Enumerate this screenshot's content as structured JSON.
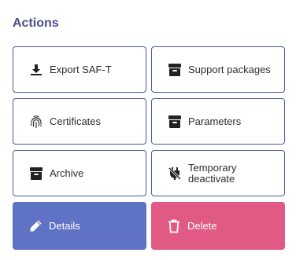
{
  "actions": {
    "title": "Actions",
    "buttons": [
      {
        "label": "Export SAF-T",
        "icon": "download-icon"
      },
      {
        "label": "Support packages",
        "icon": "archive-box-icon"
      },
      {
        "label": "Certificates",
        "icon": "fingerprint-icon"
      },
      {
        "label": "Parameters",
        "icon": "archive-box-icon"
      },
      {
        "label": "Archive",
        "icon": "archive-box-icon"
      },
      {
        "label": "Temporary deactivate",
        "icon": "unplug-icon"
      },
      {
        "label": "Details",
        "icon": "pencil-icon"
      },
      {
        "label": "Delete",
        "icon": "trash-icon"
      }
    ]
  },
  "colors": {
    "title": "#4a4e8a",
    "border": "#4a5a9c",
    "details_bg": "#5f72c4",
    "delete_bg": "#e05a83"
  }
}
